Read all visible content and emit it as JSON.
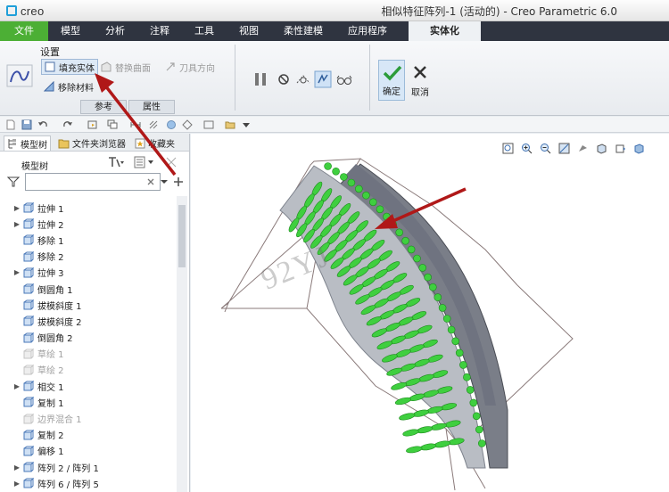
{
  "app": {
    "logo": "creo",
    "window_title": "相似特征阵列-1 (活动的) - Creo Parametric 6.0"
  },
  "menu": {
    "items": [
      "文件",
      "模型",
      "分析",
      "注释",
      "工具",
      "视图",
      "柔性建模",
      "应用程序",
      "实体化"
    ]
  },
  "ribbon": {
    "settings_title": "设置",
    "fill_solid": "填充实体",
    "replace_surface": "替换曲面",
    "tool_direction": "刀具方向",
    "remove_material": "移除材料",
    "tab_references": "参考",
    "tab_properties": "属性",
    "ok_label": "确定",
    "cancel_label": "取消"
  },
  "nav": {
    "tab_model_tree": "模型树",
    "tab_folder_browser": "文件夹浏览器",
    "tab_favorites": "收藏夹",
    "tree_title": "模型树"
  },
  "tree": {
    "items": [
      {
        "label": "拉伸 1",
        "expand": true,
        "icon": "extrude-icon",
        "grey": false
      },
      {
        "label": "拉伸 2",
        "expand": true,
        "icon": "extrude-icon",
        "grey": false
      },
      {
        "label": "移除 1",
        "expand": false,
        "icon": "remove-icon",
        "grey": false
      },
      {
        "label": "移除 2",
        "expand": false,
        "icon": "remove-icon",
        "grey": false
      },
      {
        "label": "拉伸 3",
        "expand": true,
        "icon": "extrude-icon",
        "grey": false
      },
      {
        "label": "倒圆角 1",
        "expand": false,
        "icon": "round-icon",
        "grey": false
      },
      {
        "label": "拔模斜度 1",
        "expand": false,
        "icon": "draft-icon",
        "grey": false
      },
      {
        "label": "拔模斜度 2",
        "expand": false,
        "icon": "draft-icon",
        "grey": false
      },
      {
        "label": "倒圆角 2",
        "expand": false,
        "icon": "round-icon",
        "grey": false
      },
      {
        "label": "草绘 1",
        "expand": false,
        "icon": "sketch-icon",
        "grey": true
      },
      {
        "label": "草绘 2",
        "expand": false,
        "icon": "sketch-icon",
        "grey": true
      },
      {
        "label": "相交 1",
        "expand": true,
        "icon": "intersect-icon",
        "grey": false
      },
      {
        "label": "复制 1",
        "expand": false,
        "icon": "copy-icon",
        "grey": false
      },
      {
        "label": "边界混合 1",
        "expand": false,
        "icon": "boundary-blend-icon",
        "grey": true
      },
      {
        "label": "复制 2",
        "expand": false,
        "icon": "copy-icon",
        "grey": false
      },
      {
        "label": "偏移 1",
        "expand": false,
        "icon": "offset-icon",
        "grey": false
      },
      {
        "label": "阵列 2 / 阵列 1",
        "expand": true,
        "icon": "pattern-icon",
        "grey": false
      },
      {
        "label": "阵列 6 / 阵列 5",
        "expand": true,
        "icon": "pattern-icon",
        "grey": false
      }
    ]
  },
  "graphics": {
    "watermark": "92YJ"
  },
  "colors": {
    "menu_bg": "#2f3440",
    "file_tab": "#4caf35",
    "feature_green": "#3fcf3f",
    "annotation_arrow": "#b01818"
  }
}
